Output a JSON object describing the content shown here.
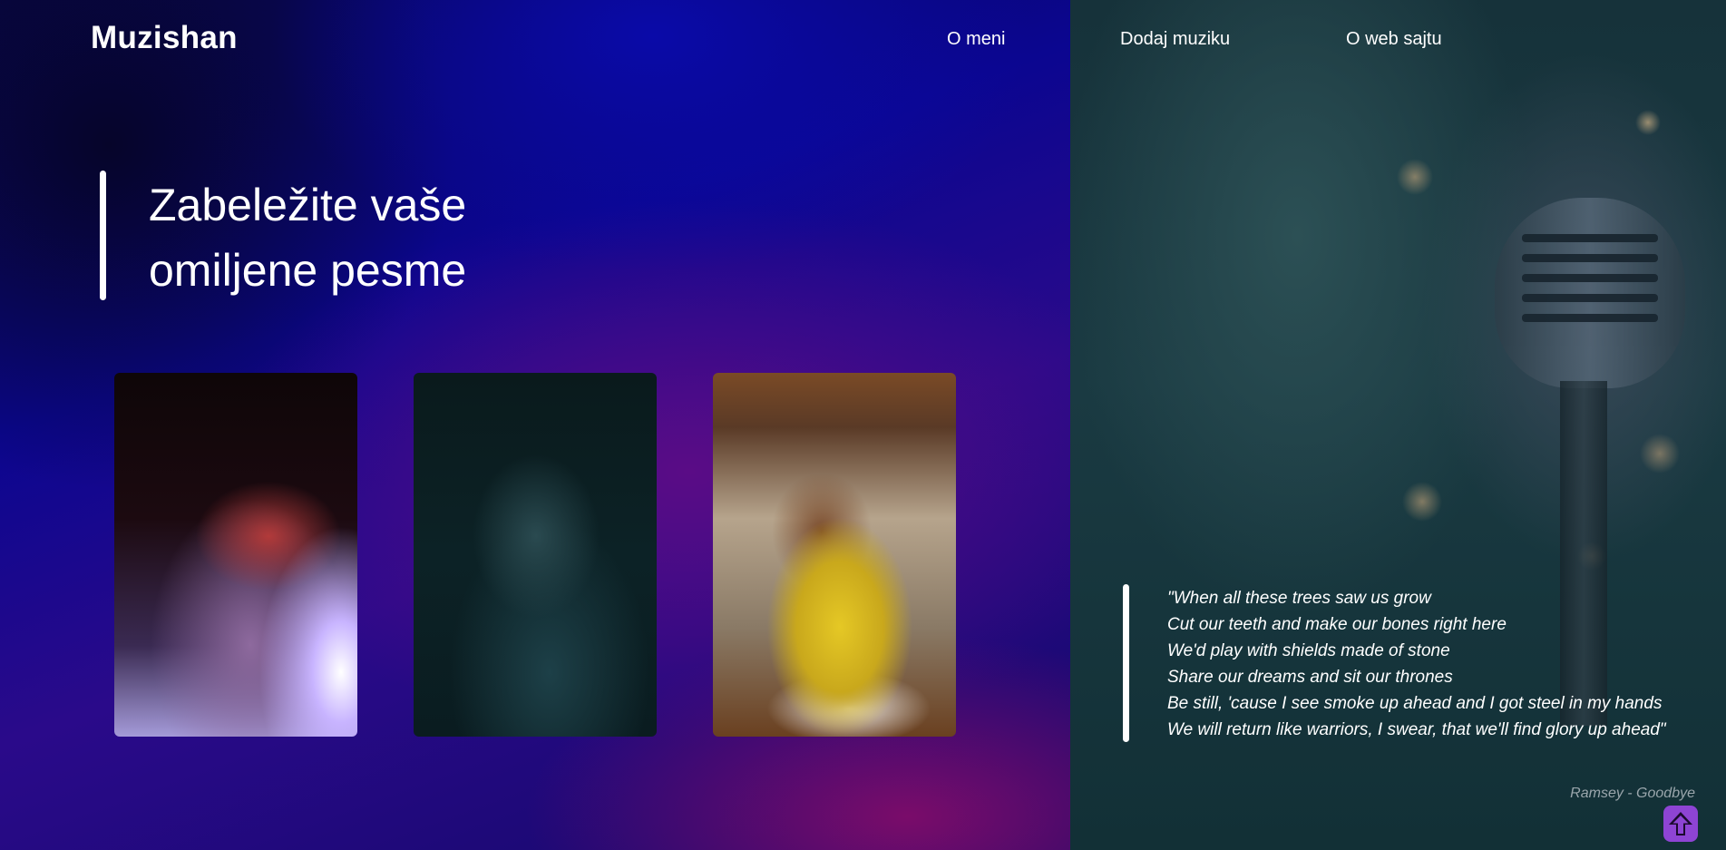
{
  "brand": {
    "logo": "Muzishan"
  },
  "nav": {
    "items": [
      {
        "label": "O meni"
      },
      {
        "label": "Dodaj muziku"
      },
      {
        "label": "O web sajtu"
      }
    ]
  },
  "hero": {
    "headline_line1": "Zabeležite vaše",
    "headline_line2": "omiljene pesme"
  },
  "gallery": {
    "photos": [
      {
        "subject": "singer-on-stage-photo"
      },
      {
        "subject": "singer-with-microphone-photo"
      },
      {
        "subject": "woman-with-headphones-photo"
      }
    ]
  },
  "quote": {
    "lines": [
      "\"When all these trees saw us grow",
      "Cut our teeth and make our bones right here",
      "We'd play with shields made of stone",
      "Share our dreams and sit our thrones",
      "Be still, 'cause I see smoke up ahead and I got steel in my hands",
      "We will return like warriors, I swear, that we'll find glory up ahead\""
    ],
    "author": "Ramsey - Goodbye"
  },
  "scroll_top": {
    "icon": "arrow-up-icon"
  },
  "colors": {
    "accent": "#8e44d4",
    "text": "#ffffff",
    "author_text": "#9aa6ac"
  }
}
